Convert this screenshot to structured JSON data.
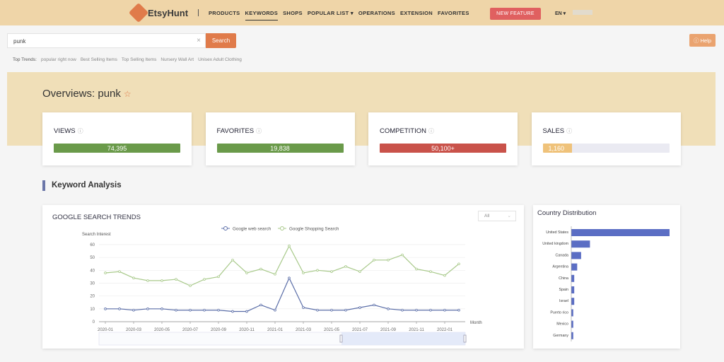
{
  "header": {
    "logo": "EtsyHunt",
    "nav": [
      "PRODUCTS",
      "KEYWORDS",
      "SHOPS",
      "POPULAR LIST ▾",
      "OPERATIONS",
      "EXTENSION",
      "FAVORITES"
    ],
    "active_nav": "KEYWORDS",
    "new_feature": "NEW FEATURE",
    "language": "EN ▾"
  },
  "search": {
    "value": "punk",
    "button": "Search",
    "help": "Help"
  },
  "top_trends": {
    "label": "Top Trends:",
    "items": [
      "popular right now",
      "Best Selling Items",
      "Top Selling Items",
      "Nursery Wall Art",
      "Unisex Adult Clothing"
    ]
  },
  "overview": {
    "title": "Overviews: punk",
    "cards": [
      {
        "label": "VIEWS",
        "value": "74,395",
        "color": "#6a9a4a",
        "fill": 1
      },
      {
        "label": "FAVORITES",
        "value": "19,838",
        "color": "#6a9a4a",
        "fill": 1
      },
      {
        "label": "COMPETITION",
        "value": "50,100+",
        "color": "#c9524a",
        "fill": 1
      },
      {
        "label": "SALES",
        "value": "1,160",
        "color": "#efc27a",
        "fill": 0.23
      }
    ]
  },
  "keyword_analysis": {
    "title": "Keyword Analysis"
  },
  "trends_panel": {
    "title": "GOOGLE SEARCH TRENDS",
    "range_select": "All"
  },
  "chart_data": [
    {
      "type": "line",
      "title": "GOOGLE SEARCH TRENDS",
      "ylabel": "Search Interest",
      "xlabel": "Month",
      "ylim": [
        0,
        60
      ],
      "yticks": [
        0,
        10,
        20,
        30,
        40,
        50,
        60
      ],
      "grid": true,
      "legend": "top-center",
      "x": [
        "2020-01",
        "2020-02",
        "2020-03",
        "2020-04",
        "2020-05",
        "2020-06",
        "2020-07",
        "2020-08",
        "2020-09",
        "2020-10",
        "2020-11",
        "2020-12",
        "2021-01",
        "2021-02",
        "2021-03",
        "2021-04",
        "2021-05",
        "2021-06",
        "2021-07",
        "2021-08",
        "2021-09",
        "2021-10",
        "2021-11",
        "2021-12",
        "2022-01",
        "2022-02"
      ],
      "xticks": [
        "2020-01",
        "2020-03",
        "2020-05",
        "2020-07",
        "2020-09",
        "2020-11",
        "2021-01",
        "2021-03",
        "2021-05",
        "2021-07",
        "2021-09",
        "2021-11",
        "2022-01"
      ],
      "series": [
        {
          "name": "Google web search",
          "color": "#5b6ea8",
          "values": [
            10,
            10,
            9,
            10,
            10,
            9,
            9,
            9,
            9,
            8,
            8,
            13,
            9,
            34,
            11,
            9,
            9,
            9,
            11,
            13,
            10,
            9,
            9,
            9,
            9,
            9
          ]
        },
        {
          "name": "Google Shopping Search",
          "color": "#a8c98a",
          "values": [
            38,
            39,
            34,
            32,
            32,
            33,
            28,
            33,
            35,
            48,
            38,
            41,
            37,
            59,
            38,
            40,
            39,
            43,
            39,
            48,
            48,
            52,
            41,
            39,
            36,
            45
          ]
        }
      ]
    },
    {
      "type": "bar",
      "orientation": "horizontal",
      "title": "Country Distribution",
      "color": "#5b6ec4",
      "categories": [
        "United States",
        "United kingdom",
        "Canada",
        "Argentina",
        "China",
        "Spain",
        "Israel",
        "Puerto rico",
        "Mexico",
        "Germany"
      ],
      "values": [
        100,
        19,
        10,
        6,
        3,
        3,
        3,
        2,
        2,
        2
      ]
    }
  ]
}
